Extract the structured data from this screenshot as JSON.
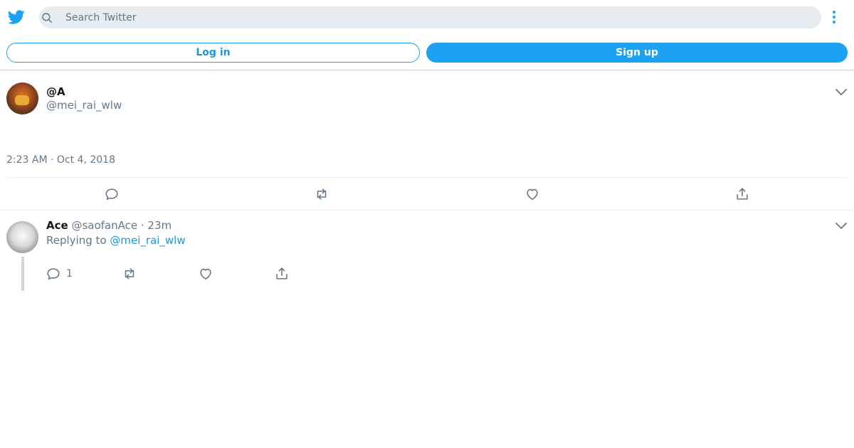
{
  "header": {
    "logo": "twitter-bird-icon",
    "search_placeholder": "Search Twitter",
    "search_value": "",
    "more_icon": "more-vertical-icon",
    "login_label": "Log in",
    "signup_label": "Sign up"
  },
  "tweet": {
    "display_name": "@A",
    "handle": "@mei_rai_wlw",
    "timestamp": "2:23 AM · Oct 4, 2018",
    "actions": [
      "reply-icon",
      "retweet-icon",
      "like-icon",
      "share-icon"
    ]
  },
  "reply": {
    "display_name": "Ace",
    "handle_time": "@saofanAce · 23m",
    "replying_prefix": "Replying to",
    "replying_to": "@mei_rai_wlw",
    "reply_count": "1",
    "actions": [
      "reply-icon",
      "retweet-icon",
      "like-icon",
      "share-icon"
    ]
  },
  "colors": {
    "brand": "#1da1f2",
    "link": "#1b95e0",
    "muted": "#657786",
    "divider": "#e6ecf0"
  }
}
